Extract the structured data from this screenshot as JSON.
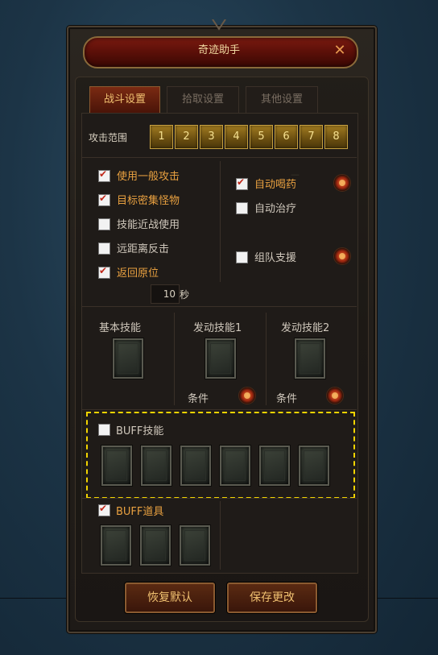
{
  "window": {
    "title": "奇迹助手",
    "close_symbol": "✕"
  },
  "tabs": [
    {
      "label": "战斗设置",
      "active": true
    },
    {
      "label": "拾取设置",
      "active": false
    },
    {
      "label": "其他设置",
      "active": false
    }
  ],
  "attack_range": {
    "label": "攻击范围",
    "options": [
      "1",
      "2",
      "3",
      "4",
      "5",
      "6",
      "7",
      "8"
    ]
  },
  "left_options": [
    {
      "label": "使用一般攻击",
      "checked": true
    },
    {
      "label": "目标密集怪物",
      "checked": true
    },
    {
      "label": "技能近战使用",
      "checked": false
    },
    {
      "label": "远距离反击",
      "checked": false
    },
    {
      "label": "返回原位",
      "checked": true
    }
  ],
  "return_seconds": {
    "value": "10",
    "unit": "秒"
  },
  "right_options": [
    {
      "label": "自动喝药",
      "checked": true,
      "settings_icon": "gear-icon"
    },
    {
      "label": "自动治疗",
      "checked": false
    },
    {
      "label": "组队支援",
      "checked": false,
      "settings_icon": "gear-icon"
    }
  ],
  "skills": {
    "basic": "基本技能",
    "active1": "发动技能1",
    "active2": "发动技能2",
    "condition": "条件"
  },
  "buff_skill": {
    "label": "BUFF技能",
    "checked": false,
    "slots": 6
  },
  "buff_item": {
    "label": "BUFF道具",
    "checked": true,
    "slots": 3
  },
  "buttons": {
    "restore": "恢复默认",
    "save": "保存更改"
  },
  "colors": {
    "accent": "#e8a040",
    "highlight_dash": "#f2d400",
    "title_red": "#5a0f08"
  }
}
